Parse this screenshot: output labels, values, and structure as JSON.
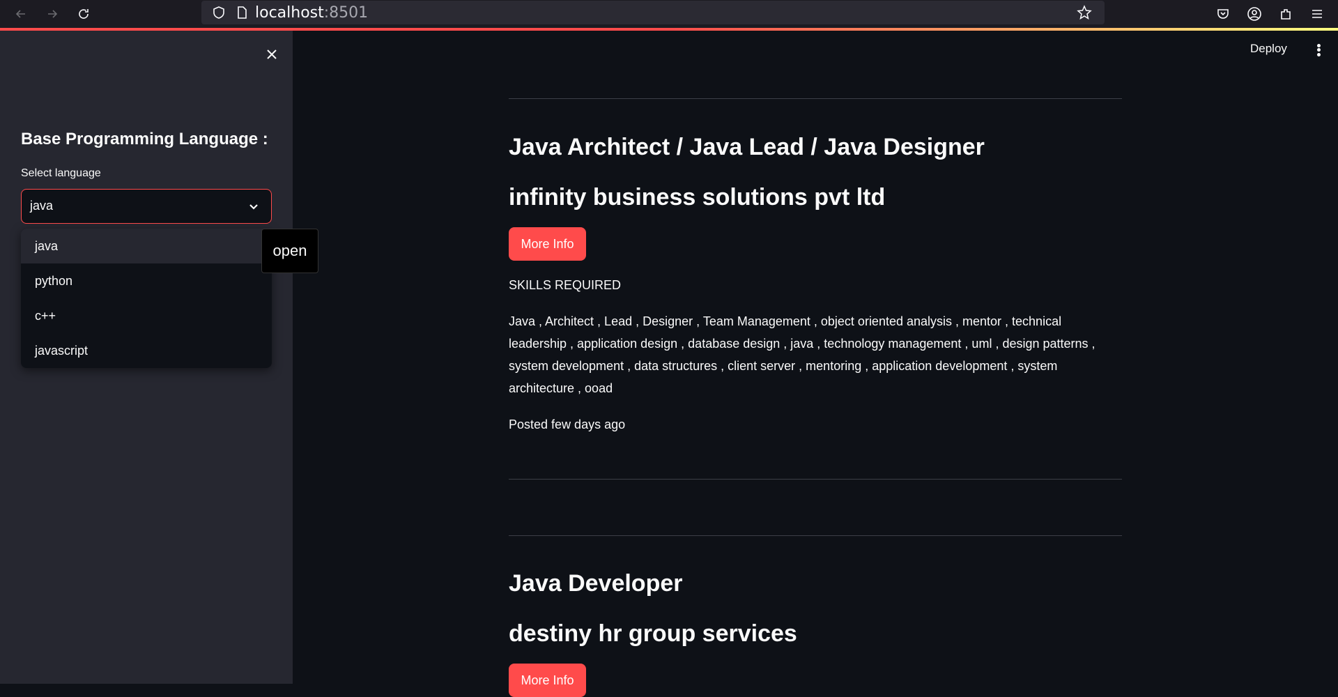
{
  "browser": {
    "url_host": "localhost",
    "url_port": ":8501"
  },
  "sidebar": {
    "heading": "Base Programming Language :",
    "select_label": "Select language",
    "selected_value": "java",
    "options": [
      "java",
      "python",
      "c++",
      "javascript"
    ],
    "tooltip": "open"
  },
  "header": {
    "deploy_label": "Deploy"
  },
  "jobs": [
    {
      "title": "Java Architect / Java Lead / Java Designer",
      "company": "infinity business solutions pvt ltd",
      "button_label": "More Info",
      "skills_heading": "SKILLS REQUIRED",
      "skills": "Java , Architect , Lead , Designer , Team Management , object oriented analysis , mentor , technical leadership , application design , database design , java , technology management , uml , design patterns , system development , data structures , client server , mentoring , application development , system architecture , ooad",
      "posted": "Posted few days ago"
    },
    {
      "title": "Java Developer",
      "company": "destiny hr group services",
      "button_label": "More Info"
    }
  ]
}
